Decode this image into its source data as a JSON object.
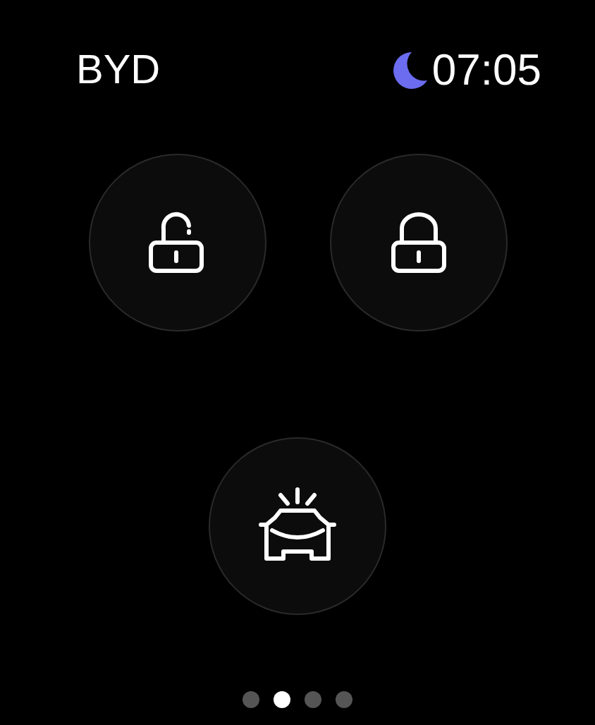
{
  "header": {
    "title": "BYD",
    "time": "07:05"
  },
  "buttons": [
    {
      "kind": "unlock"
    },
    {
      "kind": "lock"
    },
    {
      "kind": "find"
    }
  ],
  "pages": [
    {
      "selected": false
    },
    {
      "selected": true
    },
    {
      "selected": false
    },
    {
      "selected": false
    }
  ]
}
